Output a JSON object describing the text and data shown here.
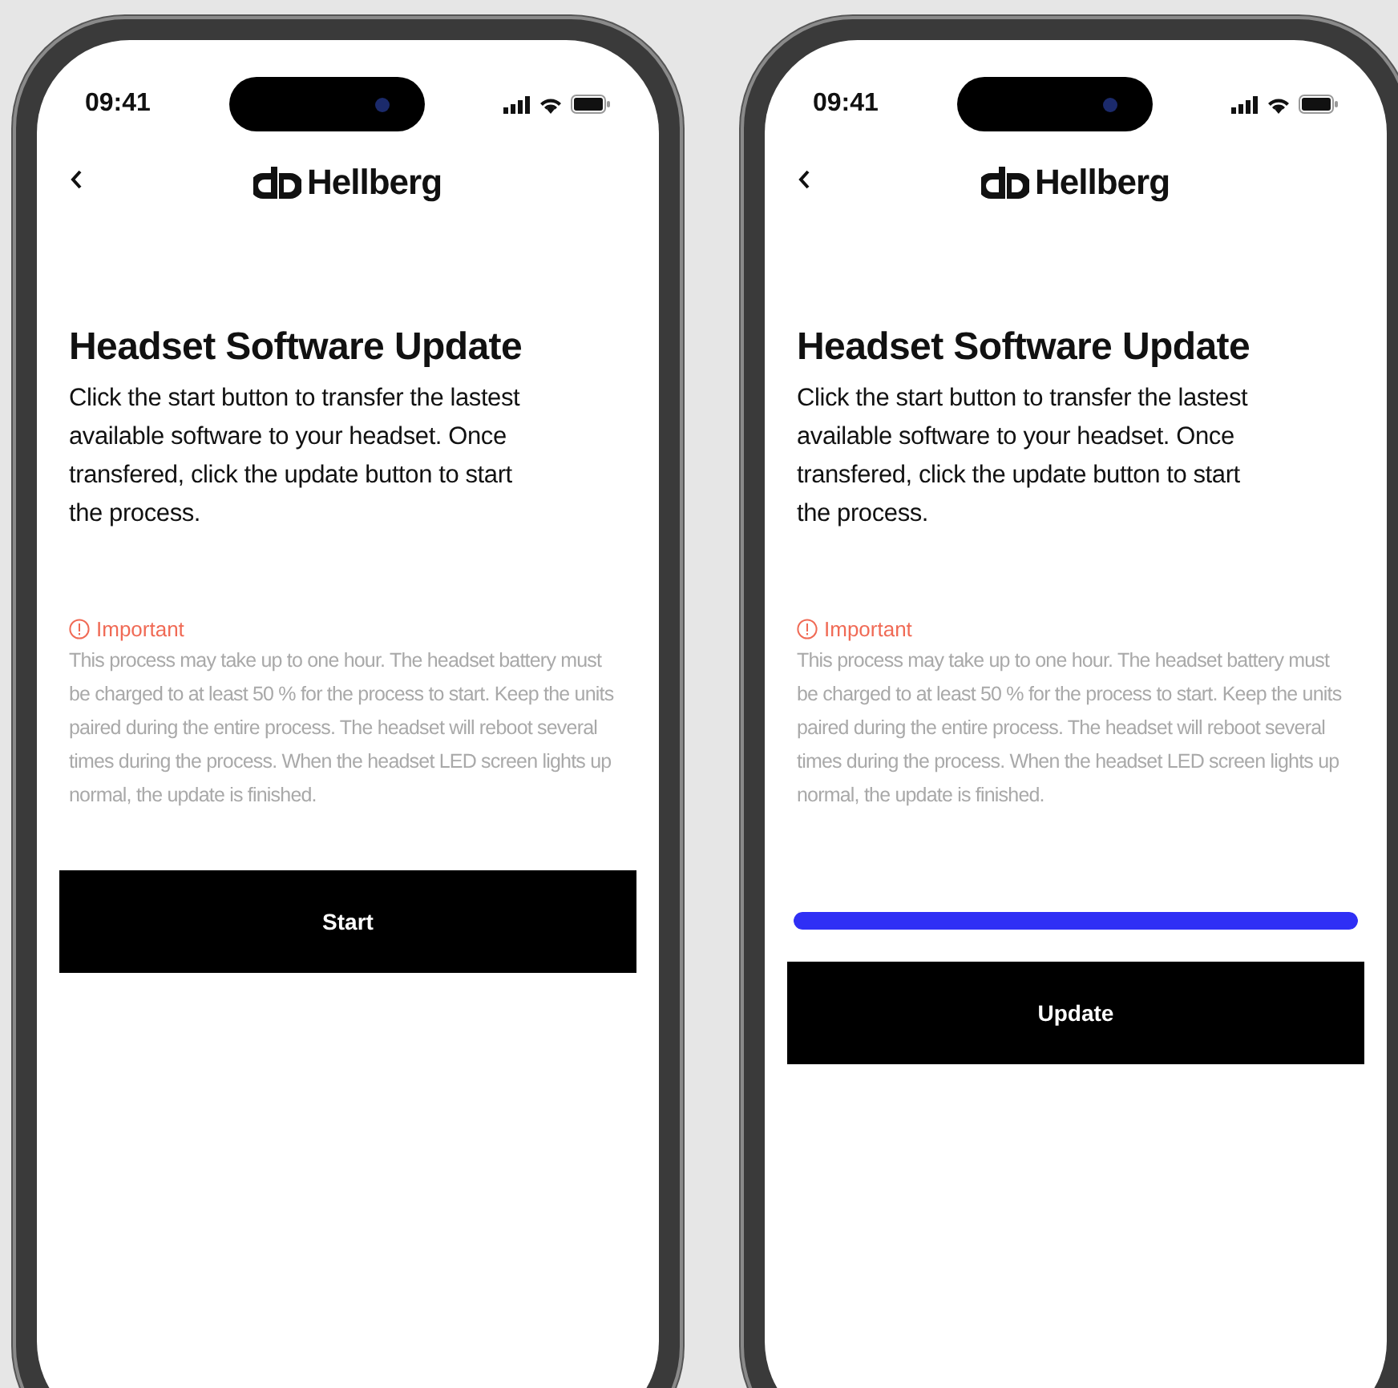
{
  "phones": [
    {
      "status_time": "09:41",
      "brand": "Hellberg",
      "title": "Headset Software Update",
      "description": "Click the start button to transfer the lastest available software to your headset. Once transfered, click the update button to start the process.",
      "important_label": "Important",
      "notice": "This process may take up to one hour. The headset battery must be charged to at least 50 % for the process to start. Keep the units paired during the entire process. The headset will reboot several times during the process. When the headset LED screen lights up normal, the update is finished.",
      "button": "Start"
    },
    {
      "status_time": "09:41",
      "brand": "Hellberg",
      "title": "Headset Software Update",
      "description": "Click the start button to transfer the lastest available software to your headset. Once transfered, click the update button to start the process.",
      "important_label": "Important",
      "notice": "This process may take up to one hour. The headset battery must be charged to at least 50 % for the process to start. Keep the units paired during the entire process. The headset will reboot several times during the process. When the headset LED screen lights up normal, the update is finished.",
      "progress": {
        "level": 1
      },
      "button": "Update"
    }
  ]
}
